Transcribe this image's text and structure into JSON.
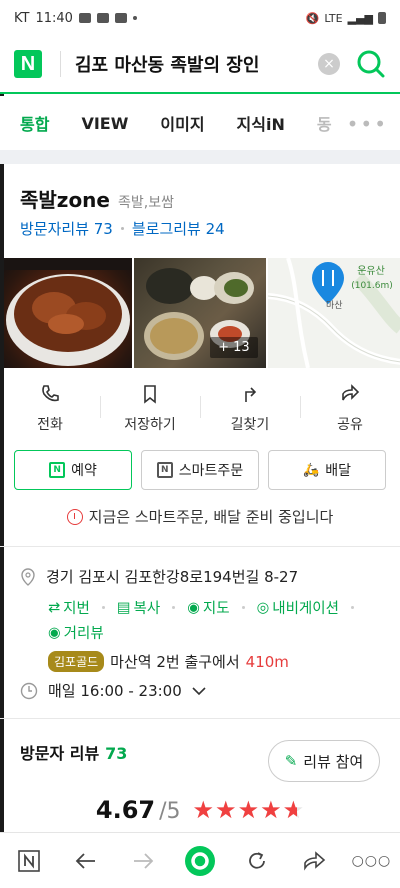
{
  "status_bar": {
    "carrier": "KT",
    "time": "11:40",
    "network": "LTE"
  },
  "search": {
    "query": "김포 마산동 족발의 장인",
    "clear_label": "×"
  },
  "tabs": [
    "통합",
    "VIEW",
    "이미지",
    "지식iN",
    "동"
  ],
  "tabs_more": "•••",
  "place": {
    "name": "족발zone",
    "category": "족발,보쌈",
    "visitor_reviews": "방문자리뷰 73",
    "blog_reviews": "블로그리뷰 24",
    "photo_more": "+ 13",
    "map_label": "운유산 (101.6m)"
  },
  "actions": [
    {
      "label": "전화",
      "icon": "phone-icon"
    },
    {
      "label": "저장하기",
      "icon": "bookmark-icon"
    },
    {
      "label": "길찾기",
      "icon": "directions-icon"
    },
    {
      "label": "공유",
      "icon": "share-icon"
    }
  ],
  "chips": [
    {
      "label": "예약",
      "icon": "reserve-icon",
      "icon_text": "N"
    },
    {
      "label": "스마트주문",
      "icon": "smart-order-icon",
      "icon_text": "N"
    },
    {
      "label": "배달",
      "icon": "delivery-icon",
      "icon_text": "🛵"
    }
  ],
  "notice": "지금은 스마트주문, 배달 준비 중입니다",
  "address": {
    "text": "경기 김포시 김포한강8로194번길 8-27",
    "links": [
      "지번",
      "복사",
      "지도",
      "내비게이션",
      "거리뷰"
    ],
    "station_badge": "김포골드",
    "station_text": "마산역 2번 출구에서",
    "distance": "410m"
  },
  "hours": "매일 16:00 - 23:00",
  "visitor_review": {
    "label": "방문자 리뷰",
    "count": "73",
    "button_label": "리뷰 참여"
  },
  "rating": {
    "score": "4.67",
    "outof": "/5",
    "stars": 4.67
  },
  "colors": {
    "accent": "#03c75a",
    "link": "#0068c3",
    "warning": "#e63c3c",
    "star": "#f04040"
  }
}
